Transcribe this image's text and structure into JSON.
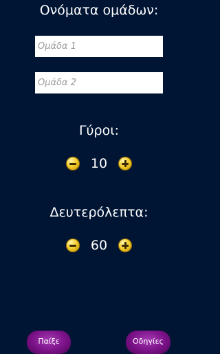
{
  "teams": {
    "title": "Ονόματα ομάδων:",
    "team1_placeholder": "Ομάδα 1",
    "team2_placeholder": "Ομάδα 2"
  },
  "rounds": {
    "title": "Γύροι:",
    "value": "10"
  },
  "seconds": {
    "title": "Δευτερόλεπτα:",
    "value": "60"
  },
  "buttons": {
    "play": "Παίξε",
    "instructions": "Οδηγίες"
  },
  "colors": {
    "background": "#001433",
    "button": "#7a1187",
    "stepper_icon": "#f2cb2a"
  },
  "icons": {
    "decrement": "minus-coin-icon",
    "increment": "plus-coin-icon"
  }
}
